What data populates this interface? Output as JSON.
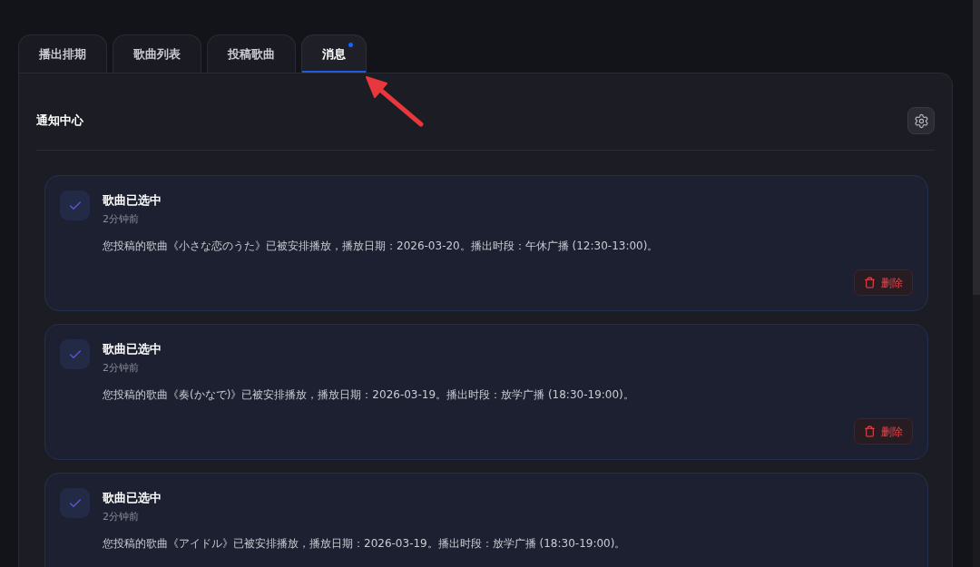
{
  "tabs": [
    {
      "label": "播出排期",
      "selected": false,
      "unread": false
    },
    {
      "label": "歌曲列表",
      "selected": false,
      "unread": false
    },
    {
      "label": "投稿歌曲",
      "selected": false,
      "unread": false
    },
    {
      "label": "消息",
      "selected": true,
      "unread": true
    }
  ],
  "panel": {
    "title": "通知中心"
  },
  "notifications": [
    {
      "title": "歌曲已选中",
      "time": "2分钟前",
      "message": "您投稿的歌曲《小さな恋のうた》已被安排播放，播放日期：2026-03-20。播出时段：午休广播 (12:30-13:00)。",
      "delete_label": "删除"
    },
    {
      "title": "歌曲已选中",
      "time": "2分钟前",
      "message": "您投稿的歌曲《奏(かなで)》已被安排播放，播放日期：2026-03-19。播出时段：放学广播 (18:30-19:00)。",
      "delete_label": "删除"
    },
    {
      "title": "歌曲已选中",
      "time": "2分钟前",
      "message": "您投稿的歌曲《アイドル》已被安排播放，播放日期：2026-03-19。播出时段：放学广播 (18:30-19:00)。"
    }
  ]
}
